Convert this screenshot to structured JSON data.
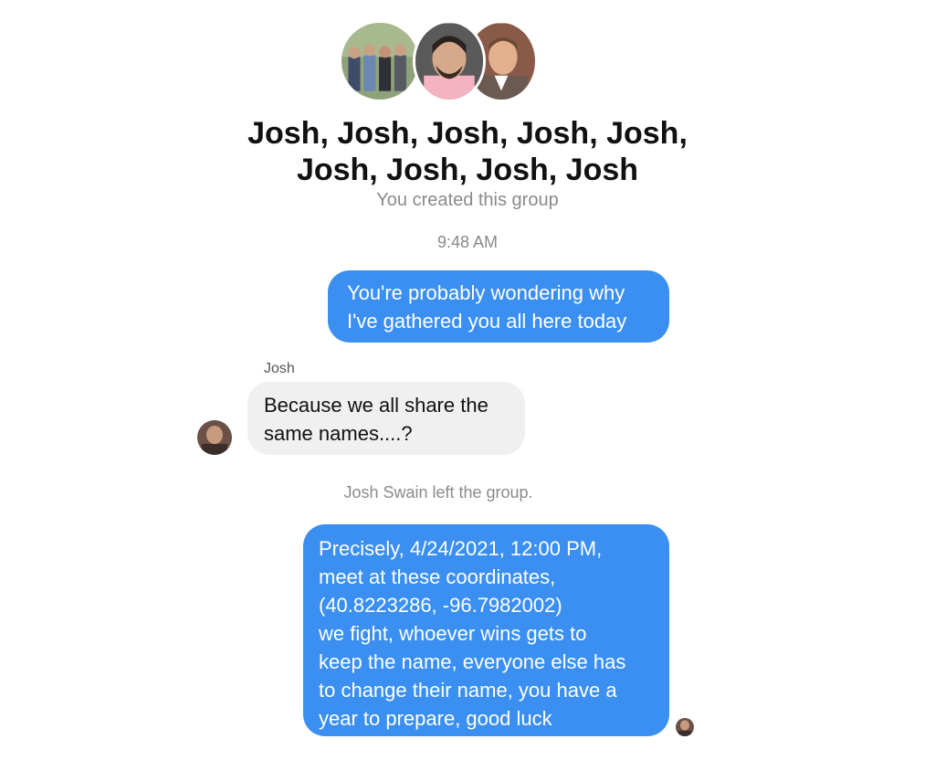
{
  "header": {
    "avatars": [
      {
        "icon": "group-photo-avatar",
        "color": "#6b7a5a"
      },
      {
        "icon": "person-avatar",
        "color": "#caa58e"
      },
      {
        "icon": "person-avatar",
        "color": "#b07a5c"
      }
    ],
    "title_line1": "Josh, Josh, Josh, Josh, Josh,",
    "title_line2": "Josh, Josh, Josh, Josh",
    "subtitle": "You created this group",
    "timestamp": "9:48 AM"
  },
  "messages": [
    {
      "direction": "outgoing",
      "lines": [
        "You're probably wondering why",
        "I've gathered you all here today"
      ]
    },
    {
      "direction": "incoming",
      "sender": "Josh",
      "lines": [
        "Because we all share the",
        "same names....?"
      ]
    },
    {
      "system_note": "Josh Swain left the group."
    },
    {
      "direction": "outgoing",
      "lines": [
        "Precisely, 4/24/2021, 12:00 PM,",
        "meet at these coordinates,",
        "(40.8223286, -96.7982002)",
        "we fight, whoever wins gets to",
        "keep the name, everyone else has",
        "to change their name, you have a",
        "year to prepare, good luck"
      ]
    }
  ],
  "colors": {
    "outgoing_bubble": "#3a8ff0",
    "incoming_bubble": "#f0f0f0",
    "meta_text": "#8a8a8a"
  }
}
